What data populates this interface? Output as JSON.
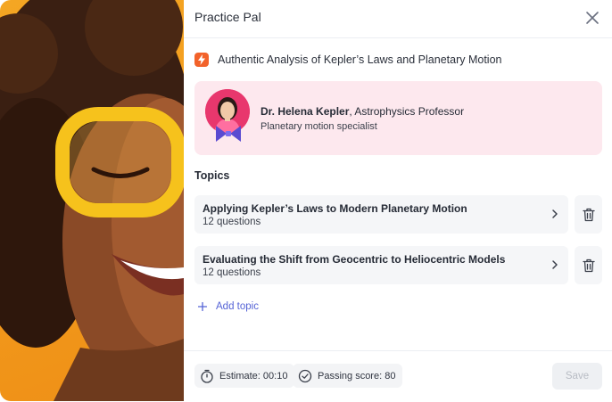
{
  "app": {
    "title": "Practice Pal"
  },
  "document": {
    "title": "Authentic Analysis of Kepler’s Laws and Planetary Motion"
  },
  "expert": {
    "name": "Dr. Helena Kepler",
    "role": ", Astrophysics Professor",
    "specialty": "Planetary motion specialist"
  },
  "topics": {
    "heading": "Topics",
    "items": [
      {
        "title": "Applying Kepler’s Laws to Modern Planetary Motion",
        "count": "12 questions"
      },
      {
        "title": "Evaluating the Shift from Geocentric to Heliocentric Models",
        "count": "12 questions"
      }
    ],
    "add_label": "Add topic"
  },
  "footer": {
    "estimate": "Estimate: 00:10",
    "passing_score": "Passing score: 80",
    "save_label": "Save"
  },
  "icons": {
    "close": "close-icon",
    "document": "lightning-icon",
    "chevron": "chevron-right-icon",
    "delete": "trash-icon",
    "add": "plus-icon",
    "timer": "stopwatch-icon",
    "check": "check-circle-icon"
  },
  "colors": {
    "accent": "#5563d6",
    "doc_icon": "#f2622a",
    "expert_card": "#fde8ee",
    "photo_bg": "#f4a623"
  }
}
